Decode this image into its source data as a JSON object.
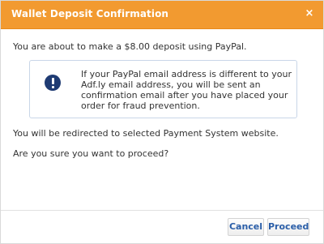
{
  "dialog": {
    "title": "Wallet Deposit Confirmation",
    "close_label": "×",
    "intro": "You are about to make a $8.00 deposit using PayPal.",
    "notice": {
      "icon": "exclamation-circle-icon",
      "text": "If your PayPal email address is different to your Adf.ly email address, you will be sent an confirmation email after you have placed your order for fraud prevention."
    },
    "redirect_text": "You will be redirected to selected Payment System website.",
    "question_text": "Are you sure you want to proceed?",
    "buttons": {
      "cancel": "Cancel",
      "proceed": "Proceed"
    }
  },
  "colors": {
    "titlebar": "#f29a30",
    "button_text": "#2a5ea8",
    "icon": "#1f3b73"
  }
}
